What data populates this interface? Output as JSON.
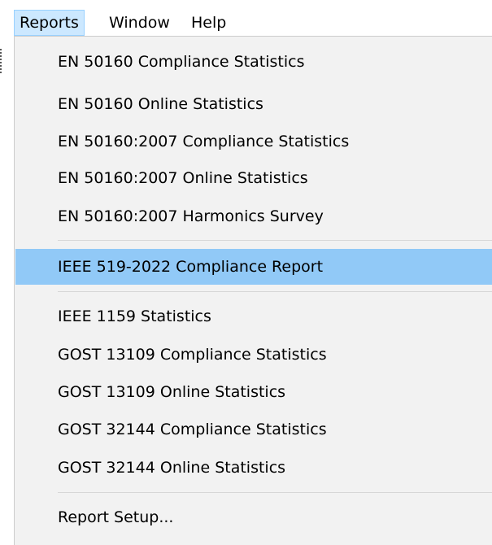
{
  "menubar": {
    "items": [
      {
        "label": "Reports",
        "active": true
      },
      {
        "label": "Window",
        "active": false
      },
      {
        "label": "Help",
        "active": false
      }
    ]
  },
  "reports_menu": {
    "groups": [
      [
        "EN 50160 Compliance Statistics",
        "EN 50160 Online Statistics",
        "EN 50160:2007 Compliance Statistics",
        "EN 50160:2007 Online Statistics",
        "EN 50160:2007 Harmonics Survey"
      ],
      [
        "IEEE 519-2022 Compliance Report"
      ],
      [
        "IEEE 1159 Statistics",
        "GOST 13109 Compliance Statistics",
        "GOST 13109 Online Statistics",
        "GOST 32144 Compliance Statistics",
        "GOST 32144 Online Statistics"
      ],
      [
        "Report Setup..."
      ]
    ],
    "highlighted_item": "IEEE 519-2022 Compliance Report"
  },
  "colors": {
    "menubar_active_bg": "#cce8ff",
    "menubar_active_border": "#99d1ff",
    "menu_bg": "#f2f2f2",
    "highlight_bg": "#91c9f7",
    "separator": "#d7d7d7"
  }
}
